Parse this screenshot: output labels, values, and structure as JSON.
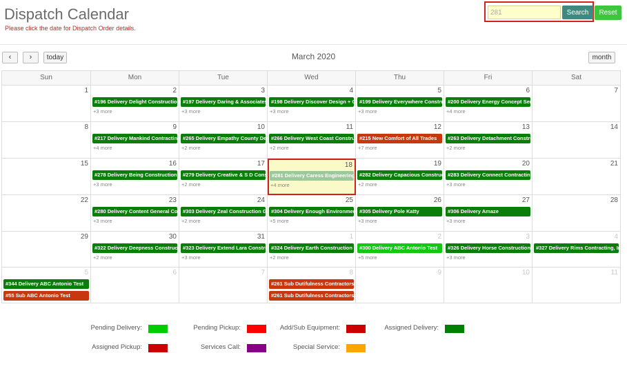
{
  "header": {
    "title": "Dispatch Calendar",
    "subtitle": "Please click the date for Dispatch Order details."
  },
  "search": {
    "value": "281",
    "search_label": "Search",
    "reset_label": "Reset"
  },
  "calendar": {
    "title": "March 2020",
    "today_label": "today",
    "month_label": "month",
    "days_of_week": [
      "Sun",
      "Mon",
      "Tue",
      "Wed",
      "Thu",
      "Fri",
      "Sat"
    ],
    "weeks": [
      [
        {
          "day": "1",
          "other": false
        },
        {
          "day": "2",
          "other": false,
          "event": "#196 Delivery Delight Construction",
          "color": "#0b7d0b",
          "more": "+3 more"
        },
        {
          "day": "3",
          "other": false,
          "event": "#197 Delivery Daring & Associates",
          "color": "#0b7d0b",
          "more": "+3 more"
        },
        {
          "day": "4",
          "other": false,
          "event": "#198 Delivery Discover Design + Co",
          "color": "#0b7d0b",
          "more": "+3 more"
        },
        {
          "day": "5",
          "other": false,
          "event": "#199 Delivery Everywhere Construc",
          "color": "#0b7d0b",
          "more": "+3 more"
        },
        {
          "day": "6",
          "other": false,
          "event": "#200 Delivery Energy Concept Serv",
          "color": "#0b7d0b",
          "more": "+4 more"
        },
        {
          "day": "7",
          "other": false
        }
      ],
      [
        {
          "day": "8",
          "other": false
        },
        {
          "day": "9",
          "other": false,
          "event": "#217 Delivery Mankind Contracting",
          "color": "#0b7d0b",
          "more": "+4 more"
        },
        {
          "day": "10",
          "other": false,
          "event": "#265 Delivery Empathy County Dev",
          "color": "#0b7d0b",
          "more": "+2 more"
        },
        {
          "day": "11",
          "other": false,
          "event": "#266 Delivery West Coast Construc",
          "color": "#0b7d0b",
          "more": "+2 more"
        },
        {
          "day": "12",
          "other": false,
          "event": "#215 New Comfort of All Trades",
          "color": "#c8380e",
          "more": "+7 more"
        },
        {
          "day": "13",
          "other": false,
          "event": "#263 Delivery Detachment Constru",
          "color": "#0b7d0b",
          "more": "+2 more"
        },
        {
          "day": "14",
          "other": false
        }
      ],
      [
        {
          "day": "15",
          "other": false
        },
        {
          "day": "16",
          "other": false,
          "event": "#278 Delivery Being Construction",
          "color": "#0b7d0b",
          "more": "+3 more"
        },
        {
          "day": "17",
          "other": false,
          "event": "#279 Delivery Creative & S D Const",
          "color": "#0b7d0b",
          "more": "+2 more"
        },
        {
          "day": "18",
          "other": false,
          "event": "#281 Delivery Caress Engineering",
          "color": "#9cc89c",
          "more": "+4 more",
          "highlight": true
        },
        {
          "day": "19",
          "other": false,
          "event": "#282 Delivery Capacious Construct",
          "color": "#0b7d0b",
          "more": "+2 more"
        },
        {
          "day": "20",
          "other": false,
          "event": "#283 Delivery Connect Contracting",
          "color": "#0b7d0b",
          "more": "+3 more"
        },
        {
          "day": "21",
          "other": false
        }
      ],
      [
        {
          "day": "22",
          "other": false
        },
        {
          "day": "23",
          "other": false,
          "event": "#280 Delivery Content General Cor",
          "color": "#0b7d0b",
          "more": "+3 more"
        },
        {
          "day": "24",
          "other": false,
          "event": "#303 Delivery Zeal Construction Gr",
          "color": "#0b7d0b",
          "more": "+2 more"
        },
        {
          "day": "25",
          "other": false,
          "event": "#304 Delivery Enough Environment",
          "color": "#0b7d0b",
          "more": "+5 more"
        },
        {
          "day": "26",
          "other": false,
          "event": "#305 Delivery Pole Katty",
          "color": "#0b7d0b",
          "more": "+3 more"
        },
        {
          "day": "27",
          "other": false,
          "event": "#306 Delivery Amaze",
          "color": "#0b7d0b",
          "more": "+3 more"
        },
        {
          "day": "28",
          "other": false
        }
      ],
      [
        {
          "day": "29",
          "other": false
        },
        {
          "day": "30",
          "other": false,
          "event": "#322 Delivery Deepness Constructi",
          "color": "#0b7d0b",
          "more": "+2 more"
        },
        {
          "day": "31",
          "other": false,
          "event": "#323 Delivery Extend Lara Construct",
          "color": "#0b7d0b",
          "more": "+3 more"
        },
        {
          "day": "1",
          "other": true,
          "event": "#324 Delivery Earth Construction",
          "color": "#0b7d0b",
          "more": "+2 more"
        },
        {
          "day": "2",
          "other": true,
          "event": "#300 Delivery ABC Antonio Test",
          "color": "#12c812",
          "more": "+5 more"
        },
        {
          "day": "3",
          "other": true,
          "event": "#326 Delivery Horse Construction,",
          "color": "#0b7d0b",
          "more": "+3 more"
        },
        {
          "day": "4",
          "other": true,
          "event": "#327 Delivery Rims Contracting, Inc",
          "color": "#0b7d0b"
        }
      ],
      [
        {
          "day": "5",
          "other": true,
          "event": "#344 Delivery ABC Antonio Test",
          "color": "#0b7d0b",
          "event2": "#55 Sub ABC Antonio Test",
          "color2": "#c8380e"
        },
        {
          "day": "6",
          "other": true
        },
        {
          "day": "7",
          "other": true
        },
        {
          "day": "8",
          "other": true,
          "event": "#261 Sub Dutifulness Contractors,",
          "color": "#c8380e",
          "event2": "#261 Sub Dutifulness Contractors,",
          "color2": "#c8380e"
        },
        {
          "day": "9",
          "other": true
        },
        {
          "day": "10",
          "other": true
        },
        {
          "day": "11",
          "other": true
        }
      ]
    ]
  },
  "legend": [
    {
      "label": "Pending Delivery:",
      "color": "#00cc00"
    },
    {
      "label": "Pending Pickup:",
      "color": "#ff0000"
    },
    {
      "label": "Add/Sub Equipment:",
      "color": "#cc0000"
    },
    {
      "label": "Assigned Delivery:",
      "color": "#008000"
    },
    {
      "label": "Assigned Pickup:",
      "color": "#cc0000"
    },
    {
      "label": "Services Call:",
      "color": "#880088"
    },
    {
      "label": "Special Service:",
      "color": "#ffa500"
    }
  ]
}
